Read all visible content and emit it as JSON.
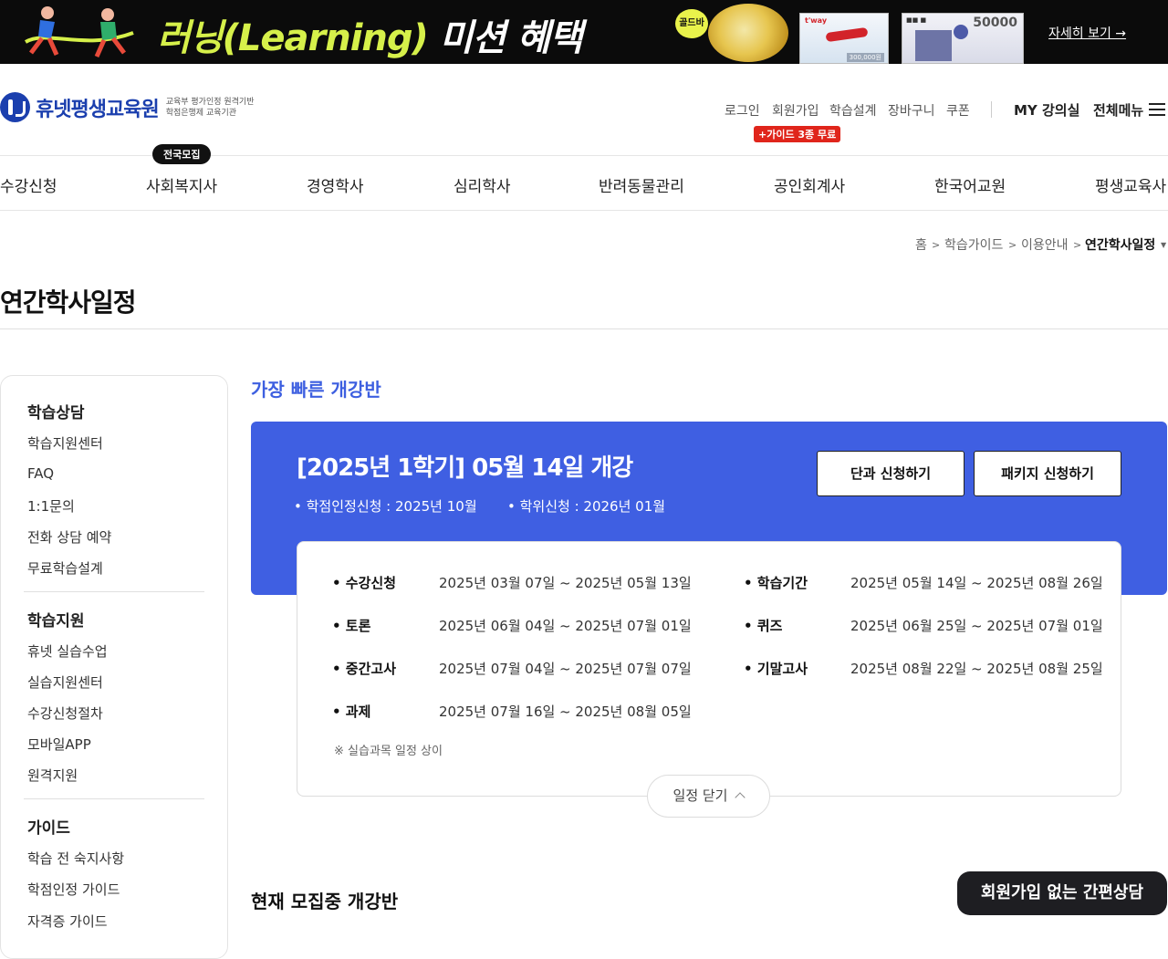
{
  "banner": {
    "headline_main": "러닝(Learning)",
    "headline_tail": " 미션 혜택",
    "gold_badge": "골드바",
    "card1_brand": "t'way",
    "card1_amount": "300,000원",
    "card2_value": "50000",
    "more_link": "자세히 보기 →"
  },
  "header": {
    "logo_name": "휴넷평생교육원",
    "logo_sub_line1": "교육부 평가인정 원격기반",
    "logo_sub_line2": "학점은행제 교육기관",
    "util": [
      "로그인",
      "회원가입",
      "학습설계",
      "장바구니",
      "쿠폰"
    ],
    "guide_badge": "+가이드 3종 무료",
    "my_lecture": "MY 강의실",
    "all_menu": "전체메뉴"
  },
  "gnb": {
    "recruit_badge": "전국모집",
    "items": [
      "수강신청",
      "사회복지사",
      "경영학사",
      "심리학사",
      "반려동물관리",
      "공인회계사",
      "한국어교원",
      "평생교육사"
    ]
  },
  "breadcrumb": [
    "홈",
    "학습가이드",
    "이용안내",
    "연간학사일정"
  ],
  "page_title": "연간학사일정",
  "sidebar": {
    "groups": [
      {
        "title": "학습상담",
        "items": [
          "학습지원센터",
          "FAQ",
          "1:1문의",
          "전화 상담 예약",
          "무료학습설계"
        ]
      },
      {
        "title": "학습지원",
        "items": [
          "휴넷 실습수업",
          "실습지원센터",
          "수강신청절차",
          "모바일APP",
          "원격지원"
        ]
      },
      {
        "title": "가이드",
        "items": [
          "학습 전 숙지사항",
          "학점인정 가이드",
          "자격증 가이드"
        ]
      }
    ]
  },
  "main": {
    "fast_title": "가장 빠른 개강반",
    "open_title": "[2025년 1학기] 05월 14일 개강",
    "credit_apply": "• 학점인정신청 : 2025년 10월",
    "degree_apply": "• 학위신청 : 2026년 01월",
    "btn_single": "단과 신청하기",
    "btn_package": "패키지 신청하기",
    "schedule": [
      {
        "label": "• 수강신청",
        "value": "2025년 03월 07일 ~ 2025년 05월 13일"
      },
      {
        "label": "• 학습기간",
        "value": "2025년 05월 14일 ~ 2025년 08월 26일"
      },
      {
        "label": "• 토론",
        "value": "2025년 06월 04일 ~ 2025년 07월 01일"
      },
      {
        "label": "• 퀴즈",
        "value": "2025년 06월 25일 ~ 2025년 07월 01일"
      },
      {
        "label": "• 중간고사",
        "value": "2025년 07월 04일 ~ 2025년 07월 07일"
      },
      {
        "label": "• 기말고사",
        "value": "2025년 08월 22일 ~ 2025년 08월 25일"
      },
      {
        "label": "• 과제",
        "value": "2025년 07월 16일 ~ 2025년 08월 05일"
      }
    ],
    "note": "※ 실습과목 일정 상이",
    "close_btn": "일정 닫기",
    "recruit_title": "현재 모집중 개강반"
  },
  "quick_consult": "회원가입 없는 간편상담",
  "colors": {
    "primary_blue": "#3f5fe2",
    "logo_blue": "#1b3fae",
    "badge_red": "#e0251b"
  }
}
